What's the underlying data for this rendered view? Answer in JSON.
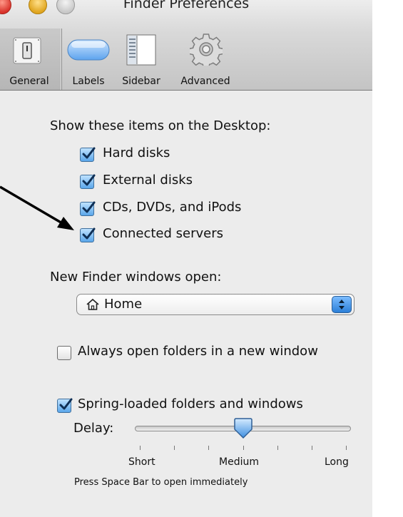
{
  "window": {
    "title": "Finder Preferences"
  },
  "toolbar": {
    "tabs": [
      {
        "label": "General",
        "icon": "switch-icon"
      },
      {
        "label": "Labels",
        "icon": "label-pill-icon"
      },
      {
        "label": "Sidebar",
        "icon": "sidebar-icon"
      },
      {
        "label": "Advanced",
        "icon": "gear-icon"
      }
    ],
    "selected": "General"
  },
  "desktop": {
    "heading": "Show these items on the Desktop:",
    "items": [
      {
        "label": "Hard disks",
        "checked": true
      },
      {
        "label": "External disks",
        "checked": true
      },
      {
        "label": "CDs, DVDs, and iPods",
        "checked": true
      },
      {
        "label": "Connected servers",
        "checked": true
      }
    ]
  },
  "new_window": {
    "label": "New Finder windows open:",
    "selected": "Home",
    "icon": "home-icon"
  },
  "always_open": {
    "label": "Always open folders in a new window",
    "checked": false
  },
  "spring_loaded": {
    "label": "Spring-loaded folders and windows",
    "checked": true,
    "delay_label": "Delay:",
    "slider_value": 0.5,
    "scale": [
      "Short",
      "Medium",
      "Long"
    ],
    "hint": "Press Space Bar to open immediately"
  },
  "colors": {
    "check_blue": "#4a90d9",
    "stepper_blue": "#2b7fd8"
  }
}
